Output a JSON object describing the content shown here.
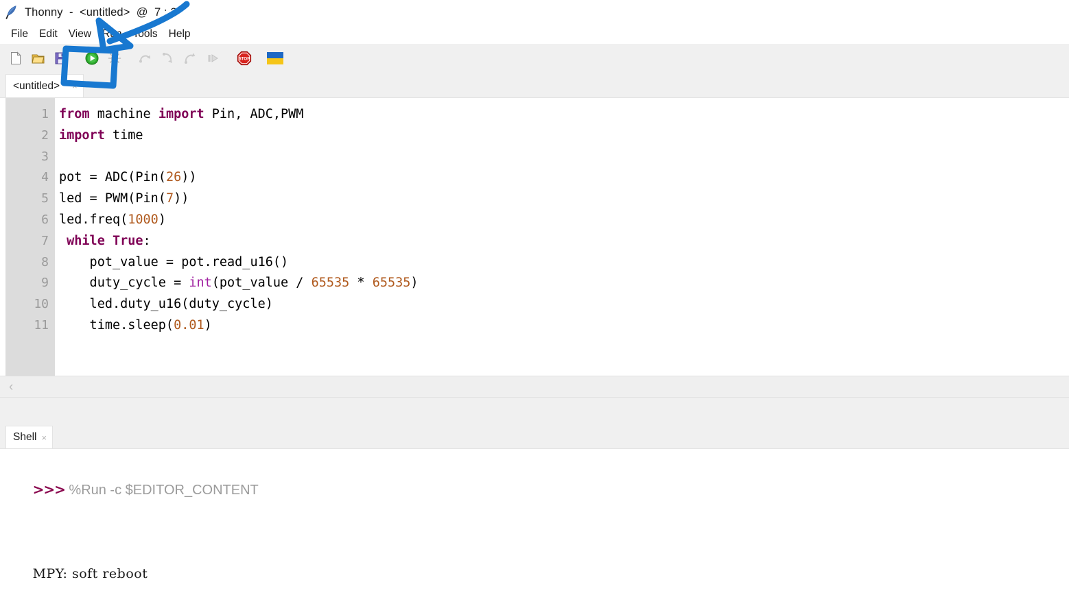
{
  "window": {
    "title": "Thonny  -  <untitled>  @  7 : 2",
    "app_icon": "feather-quill-icon"
  },
  "menu": {
    "items": [
      {
        "label": "File"
      },
      {
        "label": "Edit"
      },
      {
        "label": "View"
      },
      {
        "label": "Run"
      },
      {
        "label": "Tools"
      },
      {
        "label": "Help"
      }
    ]
  },
  "toolbar": {
    "buttons": [
      {
        "name": "new-file-icon",
        "title": "New"
      },
      {
        "name": "open-file-icon",
        "title": "Open"
      },
      {
        "name": "save-file-icon",
        "title": "Save"
      },
      {
        "name": "run-icon",
        "title": "Run current script"
      },
      {
        "name": "debug-icon",
        "title": "Debug current script"
      },
      {
        "name": "step-over-icon",
        "title": "Step over"
      },
      {
        "name": "step-into-icon",
        "title": "Step into"
      },
      {
        "name": "step-out-icon",
        "title": "Step out"
      },
      {
        "name": "resume-icon",
        "title": "Resume"
      },
      {
        "name": "stop-icon",
        "title": "Stop / Restart backend"
      },
      {
        "name": "ukraine-flag-icon",
        "title": "Support Ukraine"
      }
    ]
  },
  "editor": {
    "tab": {
      "label": "<untitled>",
      "dirty_marker": "*",
      "close_glyph": "×"
    },
    "line_numbers": [
      "1",
      "2",
      "3",
      "4",
      "5",
      "6",
      "7",
      "8",
      "9",
      "10",
      "11"
    ],
    "lines": [
      {
        "n": 1,
        "tokens": [
          {
            "t": "from ",
            "c": "kw"
          },
          {
            "t": "machine ",
            "c": ""
          },
          {
            "t": "import ",
            "c": "kw"
          },
          {
            "t": "Pin, ADC,PWM",
            "c": ""
          }
        ]
      },
      {
        "n": 2,
        "tokens": [
          {
            "t": "import ",
            "c": "kw"
          },
          {
            "t": "time",
            "c": ""
          }
        ]
      },
      {
        "n": 3,
        "tokens": [
          {
            "t": "",
            "c": ""
          }
        ]
      },
      {
        "n": 4,
        "tokens": [
          {
            "t": "pot = ADC(Pin(",
            "c": ""
          },
          {
            "t": "26",
            "c": "num"
          },
          {
            "t": "))",
            "c": ""
          }
        ]
      },
      {
        "n": 5,
        "tokens": [
          {
            "t": "led = PWM(Pin(",
            "c": ""
          },
          {
            "t": "7",
            "c": "num"
          },
          {
            "t": "))",
            "c": ""
          }
        ]
      },
      {
        "n": 6,
        "tokens": [
          {
            "t": "led.freq(",
            "c": ""
          },
          {
            "t": "1000",
            "c": "num"
          },
          {
            "t": ")",
            "c": ""
          }
        ]
      },
      {
        "n": 7,
        "tokens": [
          {
            "t": " ",
            "c": ""
          },
          {
            "t": "while",
            "c": "kw"
          },
          {
            "t": " ",
            "c": ""
          },
          {
            "t": "True",
            "c": "kw"
          },
          {
            "t": ":",
            "c": ""
          }
        ]
      },
      {
        "n": 8,
        "tokens": [
          {
            "t": "    pot_value = pot.read_u16()",
            "c": ""
          }
        ]
      },
      {
        "n": 9,
        "tokens": [
          {
            "t": "    duty_cycle = ",
            "c": ""
          },
          {
            "t": "int",
            "c": "bkw"
          },
          {
            "t": "(pot_value / ",
            "c": ""
          },
          {
            "t": "65535",
            "c": "num"
          },
          {
            "t": " * ",
            "c": ""
          },
          {
            "t": "65535",
            "c": "num"
          },
          {
            "t": ")",
            "c": ""
          }
        ]
      },
      {
        "n": 10,
        "tokens": [
          {
            "t": "    led.duty_u16(duty_cycle)",
            "c": ""
          }
        ]
      },
      {
        "n": 11,
        "tokens": [
          {
            "t": "    time.sleep(",
            "c": ""
          },
          {
            "t": "0.01",
            "c": "num"
          },
          {
            "t": ")",
            "c": ""
          }
        ]
      }
    ],
    "hscroll_arrow": "‹"
  },
  "shell": {
    "tab": {
      "label": "Shell",
      "close_glyph": "×"
    },
    "prompt": ">>>",
    "command": "%Run -c $EDITOR_CONTENT",
    "output": "MPY: soft reboot"
  },
  "annotation": {
    "color": "#1878d0",
    "shapes": [
      "arrow-pointing-to-run-button",
      "rectangle-around-run-button"
    ]
  },
  "colors": {
    "keyword": "#7f0055",
    "builtin": "#a020a0",
    "number": "#b05a1e",
    "prompt": "#8b0a50",
    "command": "#9b9b9b",
    "gutter_bg": "#dcdcdc",
    "chrome_bg": "#f0f0f0",
    "annotation_blue": "#1878d0"
  }
}
